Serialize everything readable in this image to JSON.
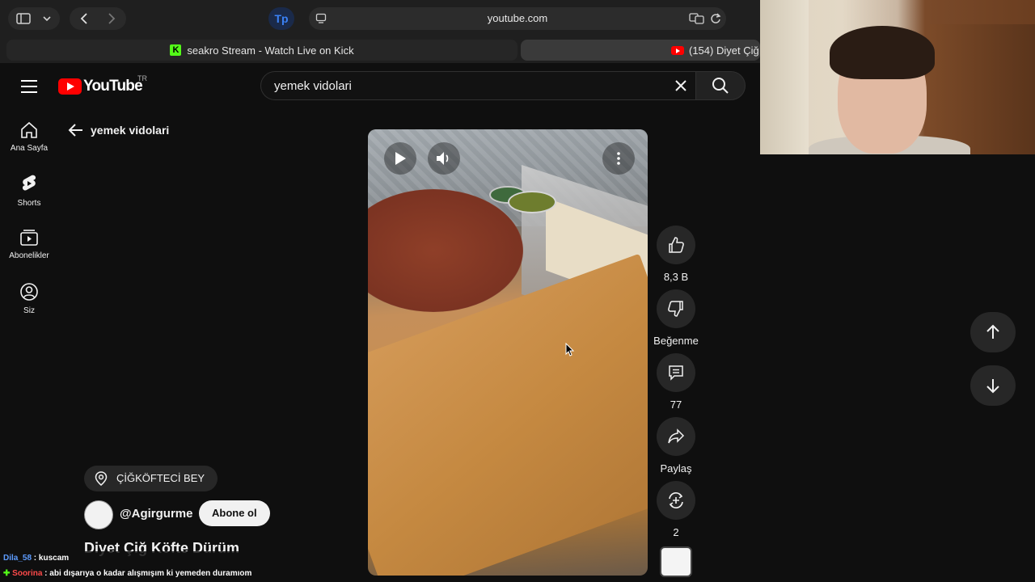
{
  "browser": {
    "address": "youtube.com",
    "tabs": [
      {
        "label": "seakro Stream - Watch Live on Kick"
      },
      {
        "label": "(154) Diyet Çiğ"
      }
    ]
  },
  "youtube": {
    "logo_text": "YouTube",
    "region": "TR",
    "search_value": "yemek vidolari",
    "nav": [
      {
        "label": "Ana Sayfa",
        "icon": "home-icon"
      },
      {
        "label": "Shorts",
        "icon": "shorts-icon"
      },
      {
        "label": "Abonelikler",
        "icon": "subscriptions-icon"
      },
      {
        "label": "Siz",
        "icon": "account-icon"
      }
    ],
    "back_label": "yemek vidolari"
  },
  "short": {
    "location": "ÇİĞKÖFTECİ BEY",
    "channel": "@Agirgurme",
    "subscribe_label": "Abone ol",
    "title": "Diyet Çiğ Köfte Dürüm",
    "actions": {
      "like_count": "8,3 B",
      "dislike_label": "Beğenme",
      "comment_count": "77",
      "share_label": "Paylaş",
      "remix_count": "2"
    }
  },
  "chat": [
    {
      "user": "Dila_58",
      "message": " : kuscam"
    },
    {
      "user": "Soorina",
      "message": " : abi dışarıya o kadar alışmışım ki yemeden duramıom"
    }
  ],
  "colors": {
    "youtube_red": "#ff0000",
    "kick_green": "#53fc18",
    "background": "#0f0f0f"
  }
}
